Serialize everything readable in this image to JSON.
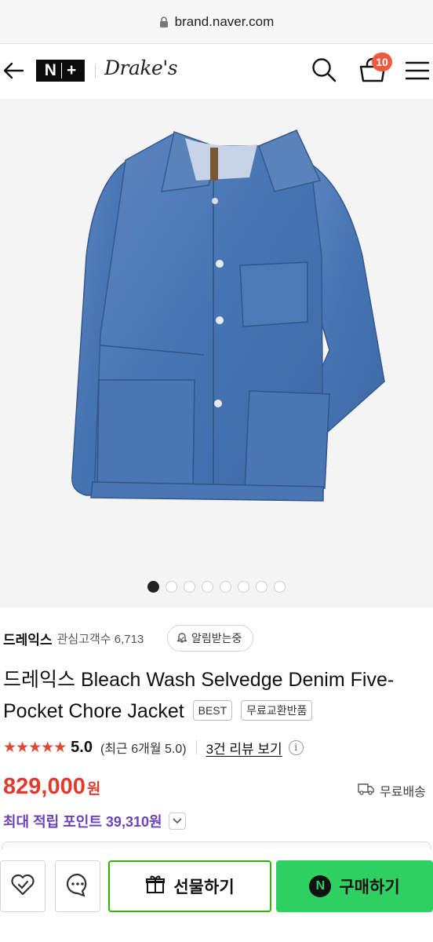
{
  "browser": {
    "url": "brand.naver.com"
  },
  "header": {
    "nplus_left": "N",
    "nplus_right": "+",
    "brand_logo": "Drake's",
    "cart_count": "10"
  },
  "gallery": {
    "total": 8,
    "active": 1
  },
  "product": {
    "seller": "드레익스",
    "followers": "관심고객수 6,713",
    "alarm_label": "알림받는중",
    "title": "드레익스 Bleach Wash Selvedge Denim Five-Pocket Chore Jacket",
    "tags": [
      "BEST",
      "무료교환반품"
    ],
    "stars": "★★★★★",
    "score": "5.0",
    "recent_score": "(최근 6개월 5.0)",
    "review_link": "3건 리뷰 보기",
    "info_symbol": "i",
    "price": "829,000",
    "currency": "원",
    "shipping": "무료배송",
    "points": "최대 적립 포인트 39,310원"
  },
  "bottom": {
    "gift_label": "선물하기",
    "buy_label": "구매하기",
    "npay_symbol": "N"
  },
  "icons": [
    "lock-icon",
    "back-arrow-icon",
    "search-icon",
    "cart-icon",
    "menu-icon",
    "bell-icon",
    "info-icon",
    "truck-icon",
    "chevron-down-icon",
    "heart-check-icon",
    "chat-icon",
    "gift-icon",
    "npay-icon"
  ],
  "colors": {
    "price": "#e23b2e",
    "points": "#6b43b8",
    "buy": "#2ed161",
    "gift_border": "#2db400",
    "badge": "#f05a3c",
    "stars": "#e0492f"
  }
}
